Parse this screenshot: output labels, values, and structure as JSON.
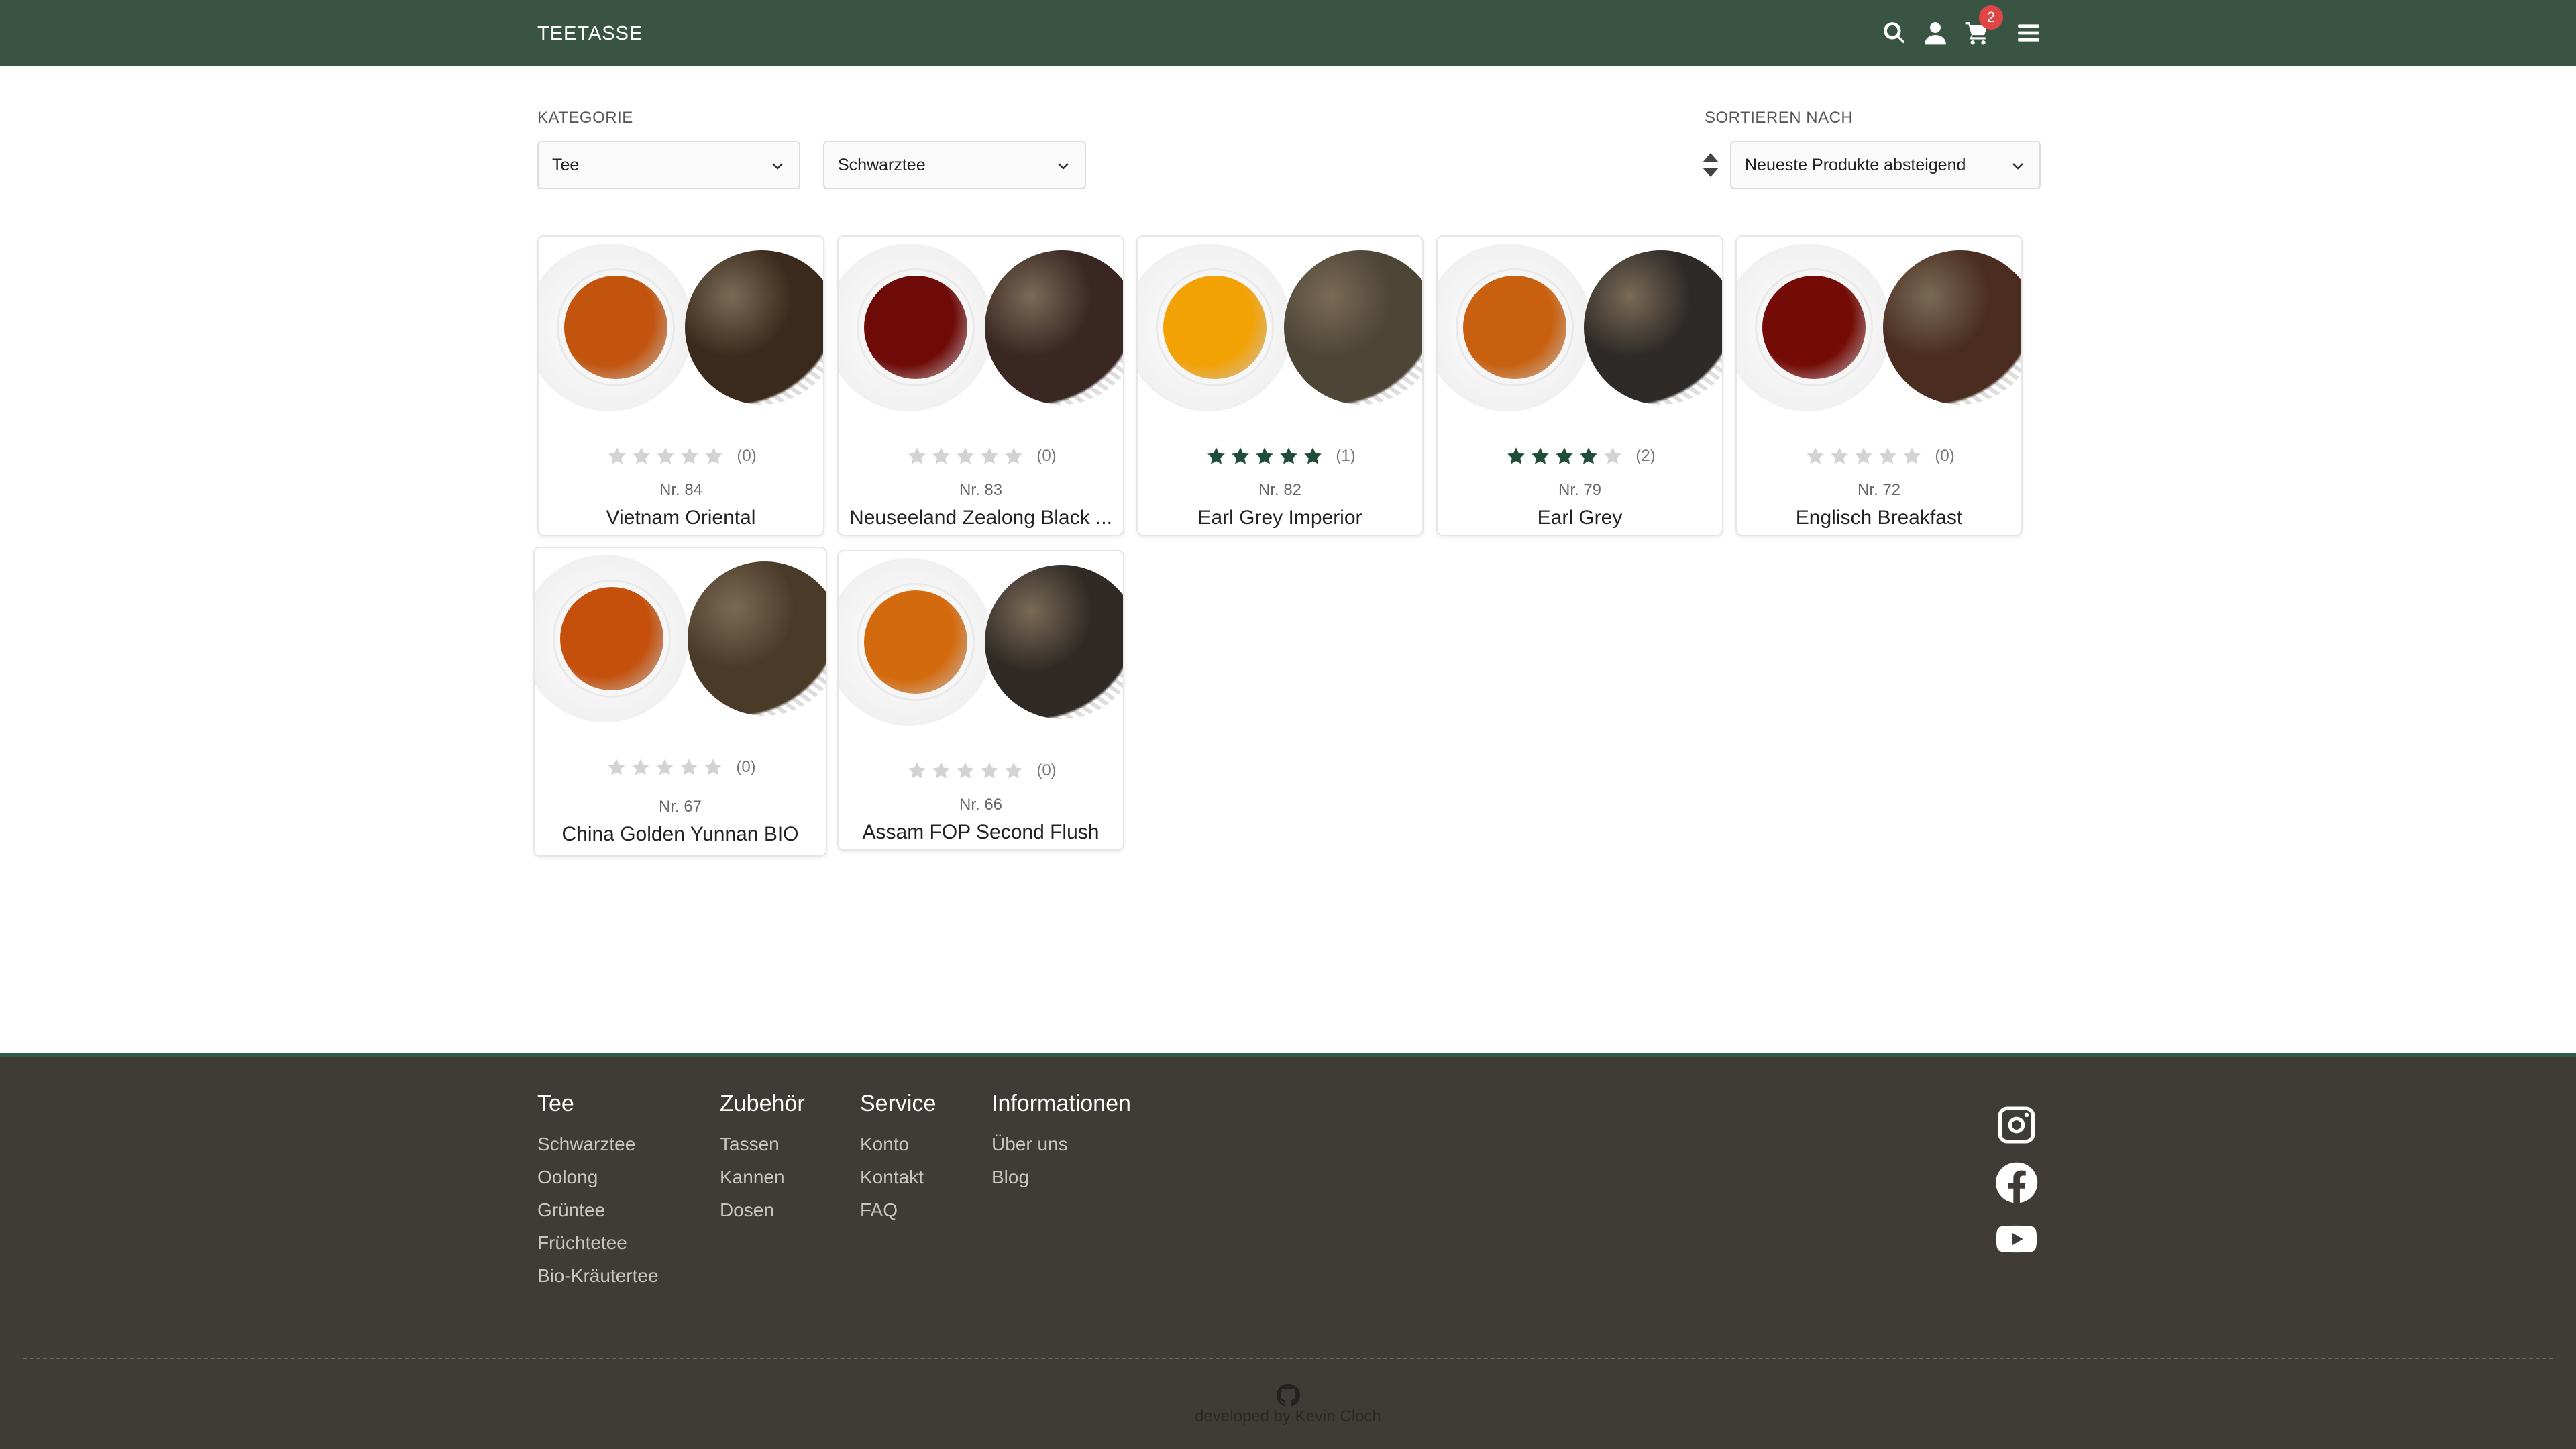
{
  "header": {
    "brand": "TEETASSE",
    "cart_count": "2",
    "icons": [
      "search-icon",
      "user-icon",
      "cart-icon",
      "menu-icon"
    ],
    "background": "#3a5444"
  },
  "filters": {
    "category_label": "KATEGORIE",
    "category_value": "Tee",
    "subcategory_value": "Schwarztee",
    "sort_label": "SORTIEREN NACH",
    "sort_value": "Neueste Produkte absteigend"
  },
  "products": [
    {
      "nr": "Nr. 84",
      "name": "Vietnam Oriental",
      "rating": 0,
      "count": "(0)",
      "tea_color": "#c2540e",
      "leaf_color": "#3b2a1c"
    },
    {
      "nr": "Nr. 83",
      "name": "Neuseeland Zealong Black ...",
      "rating": 0,
      "count": "(0)",
      "tea_color": "#6e0a08",
      "leaf_color": "#3a2622"
    },
    {
      "nr": "Nr. 82",
      "name": "Earl Grey Imperior",
      "rating": 5,
      "count": "(1)",
      "tea_color": "#f3a206",
      "leaf_color": "#4d4536"
    },
    {
      "nr": "Nr. 79",
      "name": "Earl Grey",
      "rating": 4,
      "count": "(2)",
      "tea_color": "#c9600f",
      "leaf_color": "#2d2a28"
    },
    {
      "nr": "Nr. 72",
      "name": "Englisch Breakfast",
      "rating": 0,
      "count": "(0)",
      "tea_color": "#740b06",
      "leaf_color": "#4a2c21"
    },
    {
      "nr": "Nr. 67",
      "name": "China Golden Yunnan BIO",
      "rating": 0,
      "count": "(0)",
      "tea_color": "#c4500c",
      "leaf_color": "#4a3a28"
    },
    {
      "nr": "Nr. 66",
      "name": "Assam FOP Second Flush",
      "rating": 0,
      "count": "(0)",
      "tea_color": "#d46a0e",
      "leaf_color": "#2f2a26"
    }
  ],
  "footer": {
    "columns": [
      {
        "title": "Tee",
        "links": [
          "Schwarztee",
          "Oolong",
          "Grüntee",
          "Früchtetee",
          "Bio-Kräutertee"
        ]
      },
      {
        "title": "Zubehör",
        "links": [
          "Tassen",
          "Kannen",
          "Dosen"
        ]
      },
      {
        "title": "Service",
        "links": [
          "Konto",
          "Kontakt",
          "FAQ"
        ]
      },
      {
        "title": "Informationen",
        "links": [
          "Über uns",
          "Blog"
        ]
      }
    ],
    "social": [
      "instagram-icon",
      "facebook-icon",
      "youtube-icon"
    ],
    "credit": "developed by Kevin Cloch"
  },
  "colors": {
    "star_filled": "#1f4d3a",
    "star_empty": "#d3d3d3",
    "badge": "#e04646",
    "footer_bg": "#3f3c38"
  }
}
